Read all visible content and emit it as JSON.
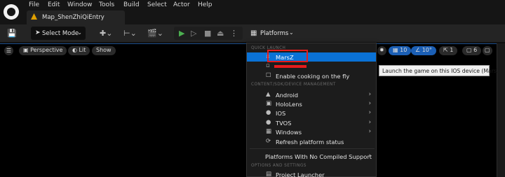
{
  "menubar": {
    "items": [
      "File",
      "Edit",
      "Window",
      "Tools",
      "Build",
      "Select",
      "Actor",
      "Help"
    ]
  },
  "level_tab": {
    "label": "Map_ShenZhiQiEntry"
  },
  "toolbar": {
    "mode_label": "Select Mode",
    "platforms_label": "Platforms"
  },
  "viewport": {
    "perspective_label": "Perspective",
    "lit_label": "Lit",
    "show_label": "Show",
    "grid_value": "10",
    "angle_value": "10°",
    "scale_value": "1",
    "camera_speed": "6"
  },
  "dropdown": {
    "quick_launch_header": "QUICK LAUNCH",
    "quick_launch": [
      {
        "label": "MarsZ",
        "selected": true
      },
      {
        "label": "",
        "selected": false
      },
      {
        "label": "Enable cooking on the fly",
        "selected": false
      }
    ],
    "device_header": "CONTENT/SDK/DEVICE MANAGEMENT",
    "platforms": [
      {
        "label": "Android",
        "icon": "android-icon"
      },
      {
        "label": "HoloLens",
        "icon": "hololens-icon"
      },
      {
        "label": "IOS",
        "icon": "apple-icon"
      },
      {
        "label": "TVOS",
        "icon": "apple-tv-icon"
      },
      {
        "label": "Windows",
        "icon": "windows-icon"
      }
    ],
    "refresh_label": "Refresh platform status",
    "no_compiled_label": "Platforms With No Compiled Support",
    "options_header": "OPTIONS AND SETTINGS",
    "project_launcher_label": "Project Launcher"
  },
  "tooltip": {
    "text": "Launch the game on this IOS device (MarsZ)"
  },
  "colors": {
    "selection": "#0a72d6",
    "annotation_red": "#e51c1c",
    "play_green": "#4caf50"
  }
}
